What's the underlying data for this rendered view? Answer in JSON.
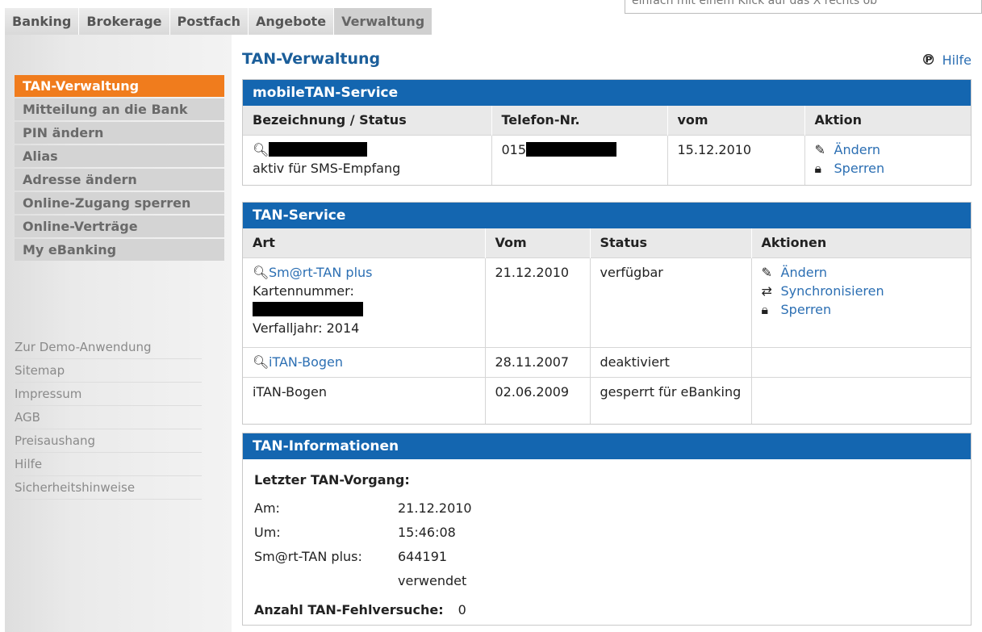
{
  "tabs": [
    "Banking",
    "Brokerage",
    "Postfach",
    "Angebote",
    "Verwaltung"
  ],
  "notice_text": "einfach mit einem Klick auf das X rechts ob",
  "sidebar": {
    "nav": [
      "TAN-Verwaltung",
      "Mitteilung an die Bank",
      "PIN ändern",
      "Alias",
      "Adresse ändern",
      "Online-Zugang sperren",
      "Online-Verträge",
      "My eBanking"
    ],
    "links": [
      "Zur Demo-Anwendung",
      "Sitemap",
      "Impressum",
      "AGB",
      "Preisaushang",
      "Hilfe",
      "Sicherheitshinweise"
    ]
  },
  "main": {
    "title": "TAN-Verwaltung",
    "help_label": "Hilfe"
  },
  "mobile": {
    "heading": "mobileTAN-Service",
    "columns": [
      "Bezeichnung / Status",
      "Telefon-Nr.",
      "vom",
      "Aktion"
    ],
    "status": "aktiv für SMS-Empfang",
    "phone_prefix": "015",
    "date": "15.12.2010",
    "action_change": "Ändern",
    "action_lock": "Sperren"
  },
  "tan": {
    "heading": "TAN-Service",
    "columns": [
      "Art",
      "Vom",
      "Status",
      "Aktionen"
    ],
    "rows": [
      {
        "name": "Sm@rt-TAN plus",
        "card_label": "Kartennummer:",
        "expiry": "Verfalljahr: 2014",
        "date": "21.12.2010",
        "status": "verfügbar"
      },
      {
        "name": "iTAN-Bogen",
        "date": "28.11.2007",
        "status": "deaktiviert"
      },
      {
        "name": "iTAN-Bogen",
        "date": "02.06.2009",
        "status": "gesperrt für eBanking"
      }
    ],
    "action_change": "Ändern",
    "action_sync": "Synchronisieren",
    "action_lock": "Sperren"
  },
  "info": {
    "heading": "TAN-Informationen",
    "last_title": "Letzter TAN-Vorgang:",
    "am_label": "Am:",
    "am_value": "21.12.2010",
    "um_label": "Um:",
    "um_value": "15:46:08",
    "smart_label": "Sm@rt-TAN plus:",
    "smart_value": "644191",
    "smart_note": "verwendet",
    "fail_label": "Anzahl TAN-Fehlversuche:",
    "fail_value": "0"
  },
  "colors": {
    "brand_blue": "#1466b0",
    "accent_orange": "#f07c1d",
    "link": "#2c6fb3"
  }
}
